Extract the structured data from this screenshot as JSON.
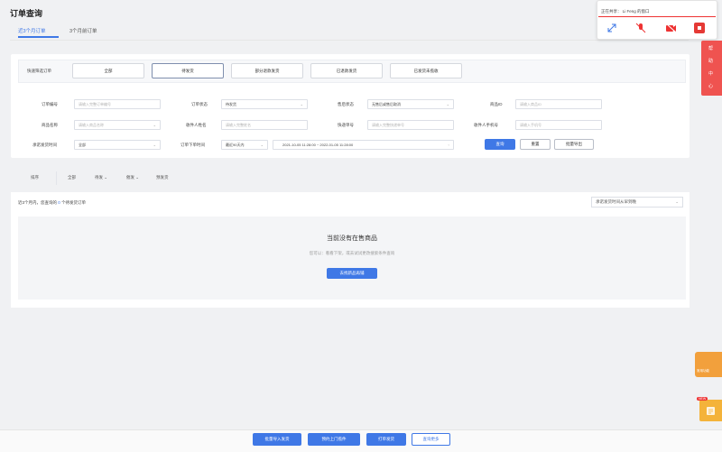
{
  "page": {
    "title": "订单查询"
  },
  "tabs": [
    {
      "label": "近3个月订单"
    },
    {
      "label": "3个月前订单"
    }
  ],
  "quick_filter": {
    "label": "快速筛选订单",
    "buttons": [
      "全部",
      "待发货",
      "部分退款发货",
      "已退款发货",
      "已发货未揽收"
    ]
  },
  "filters": {
    "row1": [
      {
        "label": "订单编号",
        "placeholder": "请输入完整订单编号"
      },
      {
        "label": "订单状态",
        "value": "待发货"
      },
      {
        "label": "售后状态",
        "value": "无售后或售后取消"
      },
      {
        "label": "商品ID",
        "placeholder": "请输入商品ID"
      }
    ],
    "row2": [
      {
        "label": "商品名称",
        "placeholder": "请输入商品名称"
      },
      {
        "label": "收件人姓名",
        "placeholder": "请输入完整姓名"
      },
      {
        "label": "快递单号",
        "placeholder": "请输入完整快递单号"
      },
      {
        "label": "收件人手机号",
        "placeholder": "请输入手机号"
      }
    ],
    "row3": {
      "label1": "承诺发货时间",
      "value1": "全部",
      "label2": "订单下单时间",
      "value2": "最近90天内",
      "date_range": "2021-10-05 11:28:00 ~ 2022-01-05 11:28:00"
    },
    "search_button": "查询",
    "reset_button": "重置",
    "export_button": "批量导出"
  },
  "sort_bar": {
    "label": "排序",
    "items": [
      "全部",
      "待发",
      "催发",
      "预发货"
    ]
  },
  "results": {
    "text_prefix": "近3个月内，您查询的",
    "count": "0",
    "text_suffix": "个待发货订单",
    "sort_option": "承诺发货时间从早到晚"
  },
  "empty_state": {
    "title": "当前没有在售商品",
    "subtitle": "您可以：看看下架，或去试试更改搜索条件查询",
    "button": "去找新品再铺"
  },
  "bottom_buttons": [
    "批量导入发货",
    "预约上门揽件",
    "打单发货",
    "查询更多"
  ],
  "popup": {
    "text": "正在共享： Li Feng 的窗口"
  },
  "side_tab": {
    "chars": [
      "帮",
      "助",
      "中",
      "心"
    ]
  },
  "float_widget": {
    "label": "常用功能"
  },
  "float_widget2": {
    "tag": "NEW"
  },
  "colors": {
    "primary": "#3f78e6",
    "side_tab": "#ef5350",
    "popup_accent": "#ee3333"
  }
}
